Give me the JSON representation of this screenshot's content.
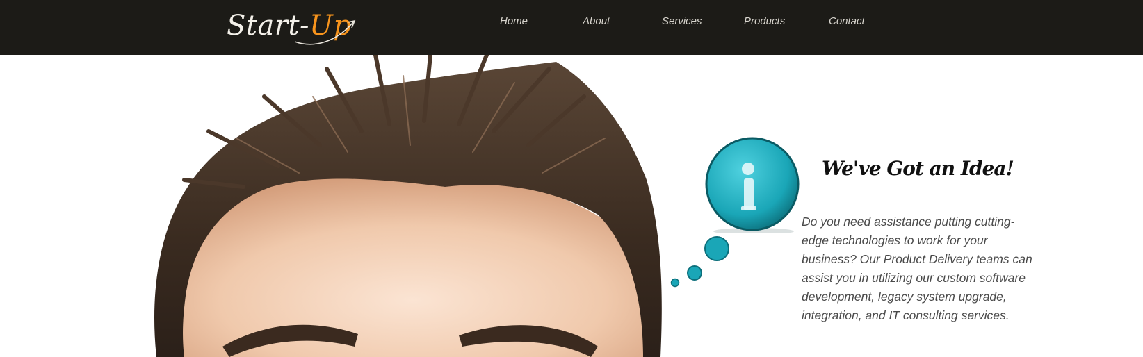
{
  "header": {
    "logo_start": "Start-",
    "logo_up": "Up",
    "nav": [
      "Home",
      "About",
      "Services",
      "Products",
      "Contact"
    ]
  },
  "hero": {
    "headline": "We've Got an Idea!",
    "body": "Do you need assistance putting cutting-edge technologies to work for your business? Our Product Delivery teams can assist you in utilizing our custom software development, legacy system upgrade, integration, and IT consulting services."
  },
  "icons": {
    "info_bubble": "info-icon"
  },
  "colors": {
    "topbar": "#1c1b17",
    "logo_accent": "#f7941d",
    "bubble": "#1aa6b7"
  }
}
